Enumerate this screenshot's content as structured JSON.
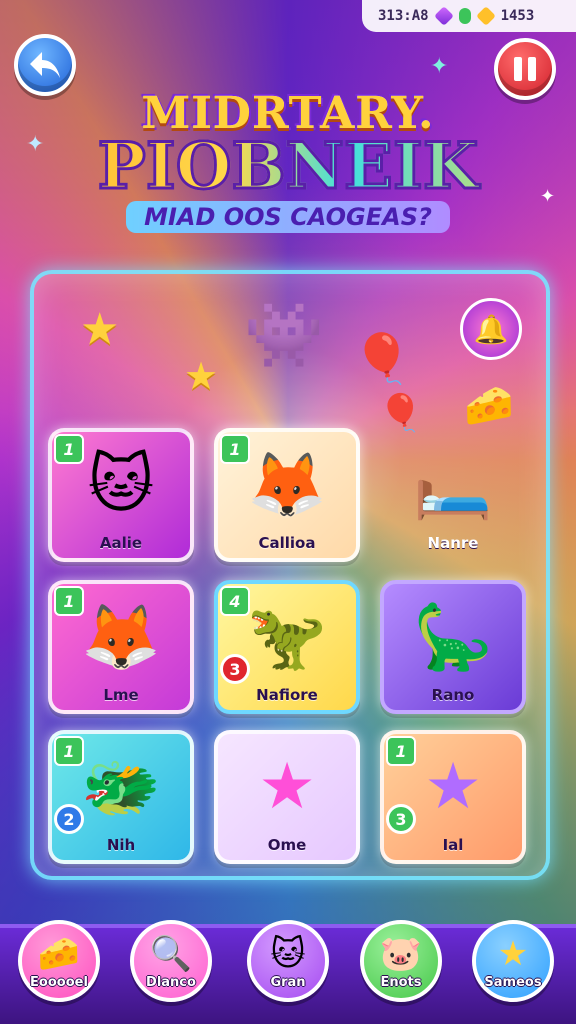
{
  "header": {
    "score": "313:A8",
    "coins": "1453"
  },
  "title": {
    "line1": "MIDRTARY.",
    "line2": "PIOBNEIK",
    "subtitle": "MIAD OOS CAOGEAS?"
  },
  "tiles": [
    {
      "label": "Aalie",
      "tag": "1",
      "icon": "cat-on-cake-icon"
    },
    {
      "label": "Callioa",
      "tag": "1",
      "icon": "fox-character-icon"
    },
    {
      "label": "Nanre",
      "tag": "",
      "icon": "bed-toy-icon"
    },
    {
      "label": "Lme",
      "tag": "1",
      "icon": "fox-on-skateboard-icon"
    },
    {
      "label": "Nafiore",
      "tag": "4",
      "badge": "3",
      "icon": "green-dino-icon"
    },
    {
      "label": "Rano",
      "tag": "",
      "icon": "slime-creature-icon"
    },
    {
      "label": "Nih",
      "tag": "1",
      "badge": "2",
      "icon": "pink-dino-icon"
    },
    {
      "label": "Ome",
      "tag": "",
      "icon": "pink-star-icon"
    },
    {
      "label": "Ial",
      "tag": "1",
      "badge": "3",
      "icon": "purple-star-icon"
    }
  ],
  "nav": [
    {
      "label": "Eooooel",
      "icon": "cheese-icon",
      "color": "#ff4fc0"
    },
    {
      "label": "Dlanco",
      "icon": "magnifier-icon",
      "color": "#ff5fd0"
    },
    {
      "label": "Gran",
      "icon": "cat-icon",
      "color": "#a54bf0"
    },
    {
      "label": "Enots",
      "icon": "pig-icon",
      "color": "#46c84a"
    },
    {
      "label": "Sameos",
      "icon": "star-icon",
      "color": "#2fa0ff"
    }
  ],
  "colors": {
    "accent_green": "#3cc45a",
    "pause_red": "#d01e2a",
    "back_blue": "#1d5fd6",
    "title_yellow": "#ffd23c"
  }
}
